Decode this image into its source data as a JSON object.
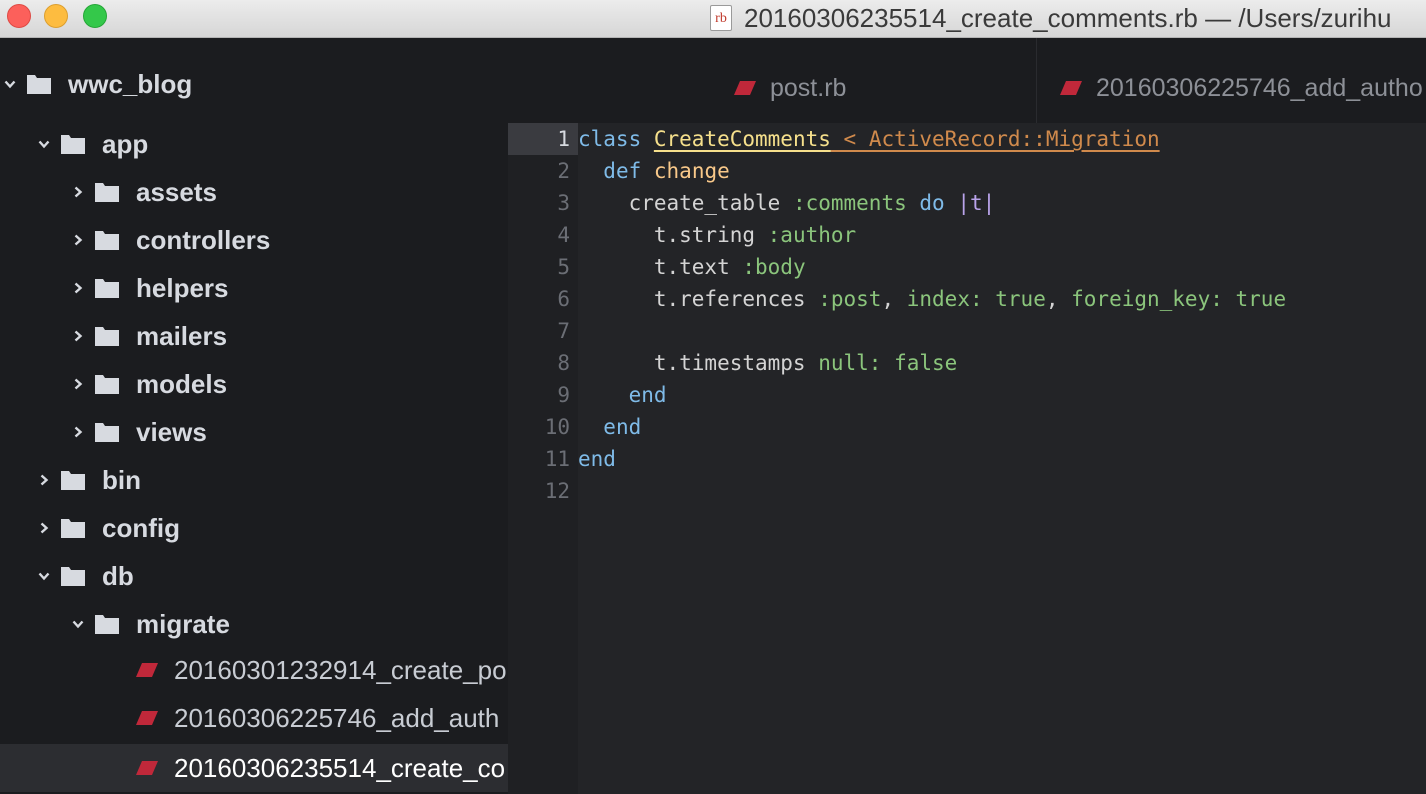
{
  "window": {
    "title": "20160306235514_create_comments.rb — /Users/zurihu",
    "file_icon_label": "rb"
  },
  "sidebar": {
    "items": [
      {
        "label": "wwc_blog",
        "type": "folder",
        "state": "expanded"
      },
      {
        "label": "app",
        "type": "folder",
        "state": "expanded"
      },
      {
        "label": "assets",
        "type": "folder",
        "state": "collapsed"
      },
      {
        "label": "controllers",
        "type": "folder",
        "state": "collapsed"
      },
      {
        "label": "helpers",
        "type": "folder",
        "state": "collapsed"
      },
      {
        "label": "mailers",
        "type": "folder",
        "state": "collapsed"
      },
      {
        "label": "models",
        "type": "folder",
        "state": "collapsed"
      },
      {
        "label": "views",
        "type": "folder",
        "state": "collapsed"
      },
      {
        "label": "bin",
        "type": "folder",
        "state": "collapsed"
      },
      {
        "label": "config",
        "type": "folder",
        "state": "collapsed"
      },
      {
        "label": "db",
        "type": "folder",
        "state": "expanded"
      },
      {
        "label": "migrate",
        "type": "folder",
        "state": "expanded"
      },
      {
        "label": "20160301232914_create_po",
        "type": "file"
      },
      {
        "label": "20160306225746_add_auth",
        "type": "file"
      },
      {
        "label": "20160306235514_create_co",
        "type": "file",
        "selected": true
      }
    ]
  },
  "tabs": [
    {
      "label": "post.rb",
      "icon": "ruby-icon"
    },
    {
      "label": "20160306225746_add_autho",
      "icon": "ruby-icon"
    }
  ],
  "editor": {
    "active_line": 1,
    "line_numbers": [
      "1",
      "2",
      "3",
      "4",
      "5",
      "6",
      "7",
      "8",
      "9",
      "10",
      "11",
      "12"
    ],
    "lines": {
      "l1": {
        "kw": "class",
        "sp": " ",
        "cls": "CreateComments",
        "inh": " < ActiveRecord::Migration"
      },
      "l2": {
        "indent": "  ",
        "kw": "def",
        "sp": " ",
        "fn": "change"
      },
      "l3": {
        "indent": "    ",
        "a": "create_table ",
        "sym": ":comments",
        "sp": " ",
        "kw": "do",
        "sp2": " ",
        "pipe": "|t|"
      },
      "l4": {
        "indent": "      ",
        "a": "t.string ",
        "sym": ":author"
      },
      "l5": {
        "indent": "      ",
        "a": "t.text ",
        "sym": ":body"
      },
      "l6": {
        "indent": "      ",
        "a": "t.references ",
        "sym": ":post",
        "c1": ", ",
        "k1": "index:",
        "s1": " ",
        "v1": "true",
        "c2": ", ",
        "k2": "foreign_key:",
        "s2": " ",
        "v2": "true"
      },
      "l7": {
        "text": ""
      },
      "l8": {
        "indent": "      ",
        "a": "t.timestamps ",
        "k1": "null:",
        "s1": " ",
        "v1": "false"
      },
      "l9": {
        "indent": "    ",
        "kw": "end"
      },
      "l10": {
        "indent": "  ",
        "kw": "end"
      },
      "l11": {
        "kw": "end"
      },
      "l12": {
        "text": ""
      }
    }
  },
  "colors": {
    "keyword": "#7fbbe8",
    "class_name": "#f6e08c",
    "inherit": "#d08a4c",
    "method": "#f9c98a",
    "symbol": "#8bc57c",
    "ruby_icon": "#c0283a"
  }
}
